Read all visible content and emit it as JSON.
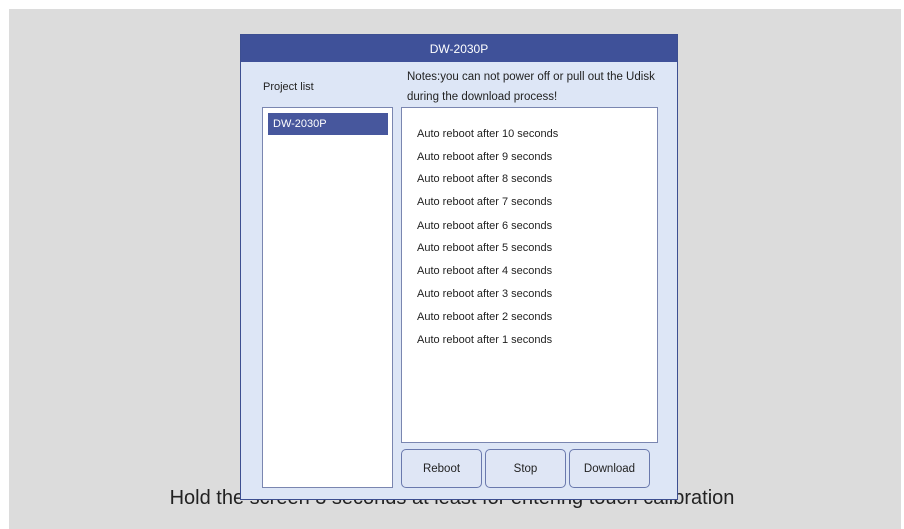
{
  "window": {
    "title": "DW-2030P"
  },
  "project_list": {
    "label": "Project list",
    "items": [
      "DW-2030P"
    ]
  },
  "notes": "Notes:you can not power off or pull out the Udisk during the download process!",
  "log": [
    "Auto reboot after 10 seconds",
    "Auto reboot after 9 seconds",
    "Auto reboot after 8 seconds",
    "Auto reboot after 7 seconds",
    "Auto reboot after 6 seconds",
    "Auto reboot after 5 seconds",
    "Auto reboot after 4 seconds",
    "Auto reboot after 3 seconds",
    "Auto reboot after 2 seconds",
    "Auto reboot after 1 seconds"
  ],
  "buttons": {
    "reboot": "Reboot",
    "stop": "Stop",
    "download": "Download"
  },
  "caption": "Hold the screen 3 seconds at least for entering touch calibration",
  "colors": {
    "titlebar": "#3f5199",
    "window_bg": "#dde6f6",
    "selected_item": "#47579d",
    "screen_bg": "#dcdcdc"
  }
}
